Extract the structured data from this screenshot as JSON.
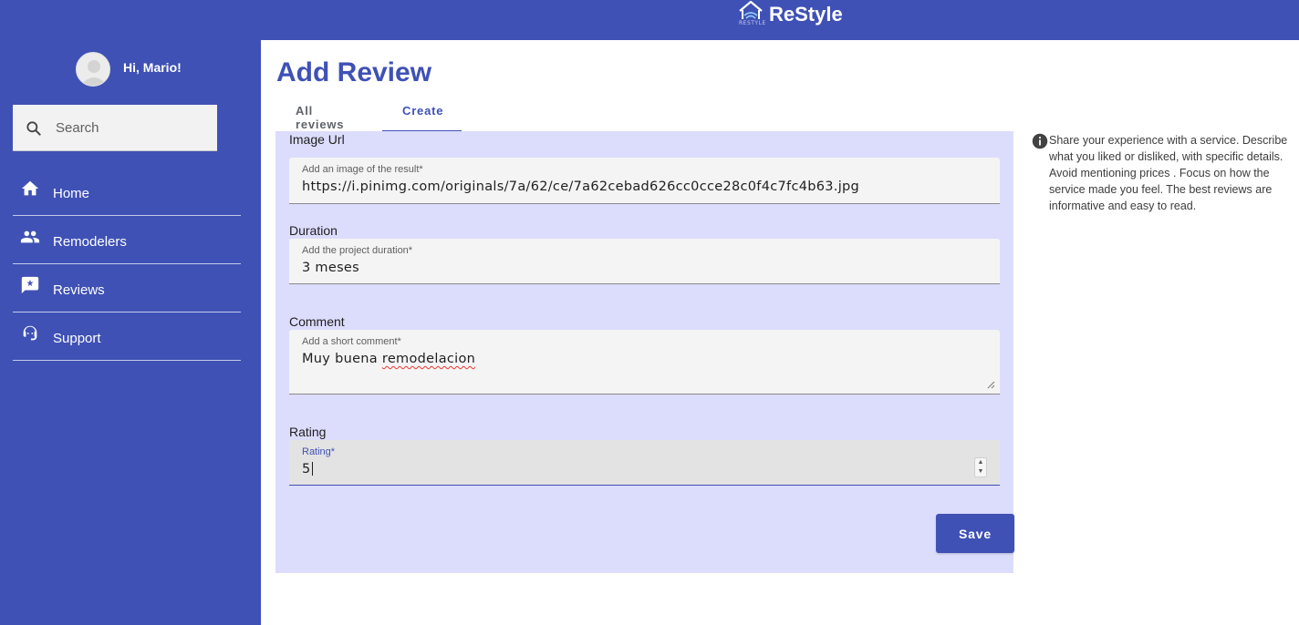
{
  "brand": {
    "name": "ReStyle",
    "sub": "RESTYLE",
    "color": "#3f51b5"
  },
  "sidebar": {
    "greeting": "Hi, Mario!",
    "search_placeholder": "Search",
    "items": [
      {
        "label": "Home",
        "icon": "home-icon"
      },
      {
        "label": "Remodelers",
        "icon": "people-icon"
      },
      {
        "label": "Reviews",
        "icon": "rate-review-icon"
      },
      {
        "label": "Support",
        "icon": "support-agent-icon"
      }
    ]
  },
  "main": {
    "title": "Add Review",
    "tabs": [
      {
        "label": "All reviews",
        "active": false
      },
      {
        "label": "Create",
        "active": true
      }
    ],
    "form": {
      "image": {
        "label": "Image Url",
        "hint": "Add an image of the result*",
        "value": "https://i.pinimg.com/originals/7a/62/ce/7a62cebad626cc0cce28c0f4c7fc4b63.jpg"
      },
      "duration": {
        "label": "Duration",
        "hint": "Add the project duration*",
        "value": "3 meses"
      },
      "comment": {
        "label": "Comment",
        "hint": "Add a short comment*",
        "value_prefix": "Muy buena ",
        "value_misspelled": "remodelacion"
      },
      "rating": {
        "label": "Rating",
        "hint": "Rating*",
        "value": "5"
      },
      "save_label": "Save"
    },
    "info": "Share your experience with a service. Describe what you liked or disliked, with specific details. Avoid mentioning prices . Focus on how the service made you feel. The best reviews are informative and easy to read."
  }
}
